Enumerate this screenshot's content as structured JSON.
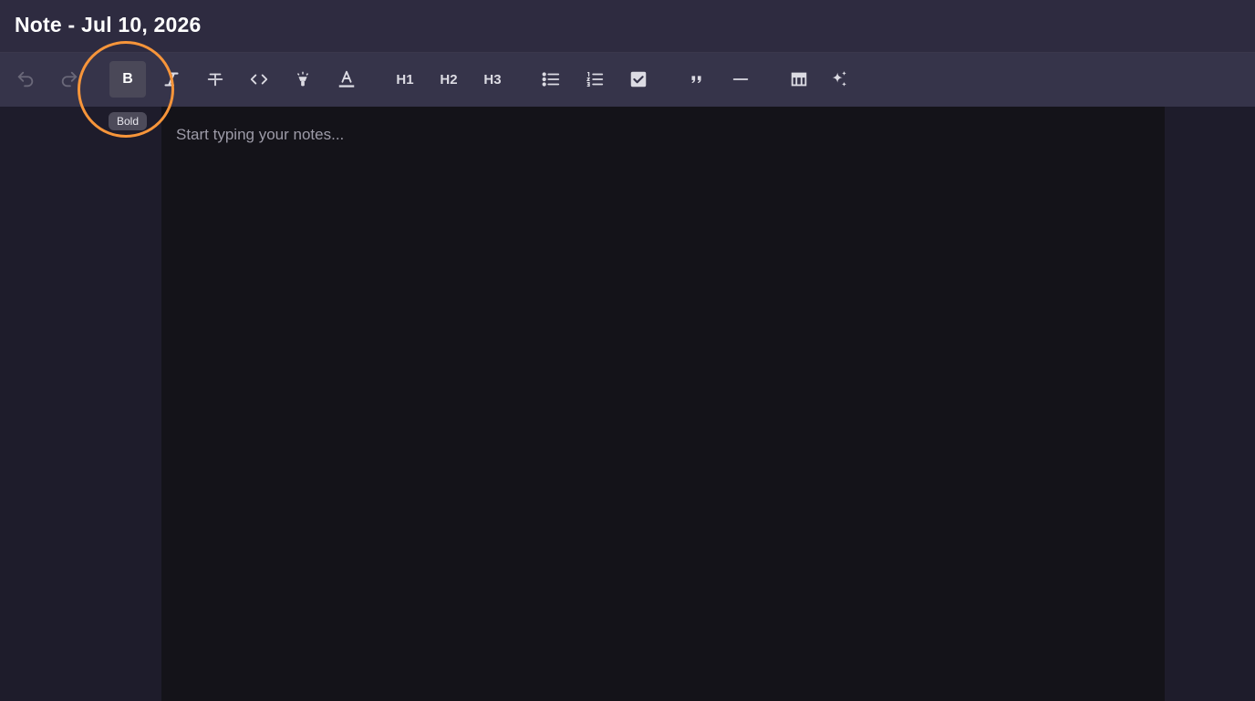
{
  "header": {
    "title": "Note - Jul 10, 2026"
  },
  "toolbar": {
    "tools": [
      {
        "id": "undo",
        "icon": "undo-icon",
        "enabled": false
      },
      {
        "id": "redo",
        "icon": "redo-icon",
        "enabled": false
      },
      {
        "id": "bold",
        "label": "B",
        "active": true
      },
      {
        "id": "italic",
        "icon": "italic-icon"
      },
      {
        "id": "strikethrough",
        "icon": "strikethrough-icon"
      },
      {
        "id": "code",
        "icon": "code-icon"
      },
      {
        "id": "highlight",
        "icon": "highlighter-icon"
      },
      {
        "id": "text-color",
        "icon": "text-color-icon"
      },
      {
        "id": "h1",
        "label": "H1"
      },
      {
        "id": "h2",
        "label": "H2"
      },
      {
        "id": "h3",
        "label": "H3"
      },
      {
        "id": "bullet-list",
        "icon": "bullet-list-icon"
      },
      {
        "id": "ordered-list",
        "icon": "ordered-list-icon"
      },
      {
        "id": "task-list",
        "icon": "checkbox-icon"
      },
      {
        "id": "blockquote",
        "icon": "quote-icon"
      },
      {
        "id": "horizontal-rule",
        "icon": "horizontal-rule-icon"
      },
      {
        "id": "table",
        "icon": "table-icon"
      },
      {
        "id": "ai",
        "icon": "sparkles-icon"
      }
    ],
    "tooltip": "Bold"
  },
  "editor": {
    "placeholder": "Start typing your notes..."
  },
  "colors": {
    "header_bg": "#2e2b40",
    "toolbar_bg": "#36344a",
    "editor_bg": "#141319",
    "highlight_ring": "#f7953a"
  }
}
